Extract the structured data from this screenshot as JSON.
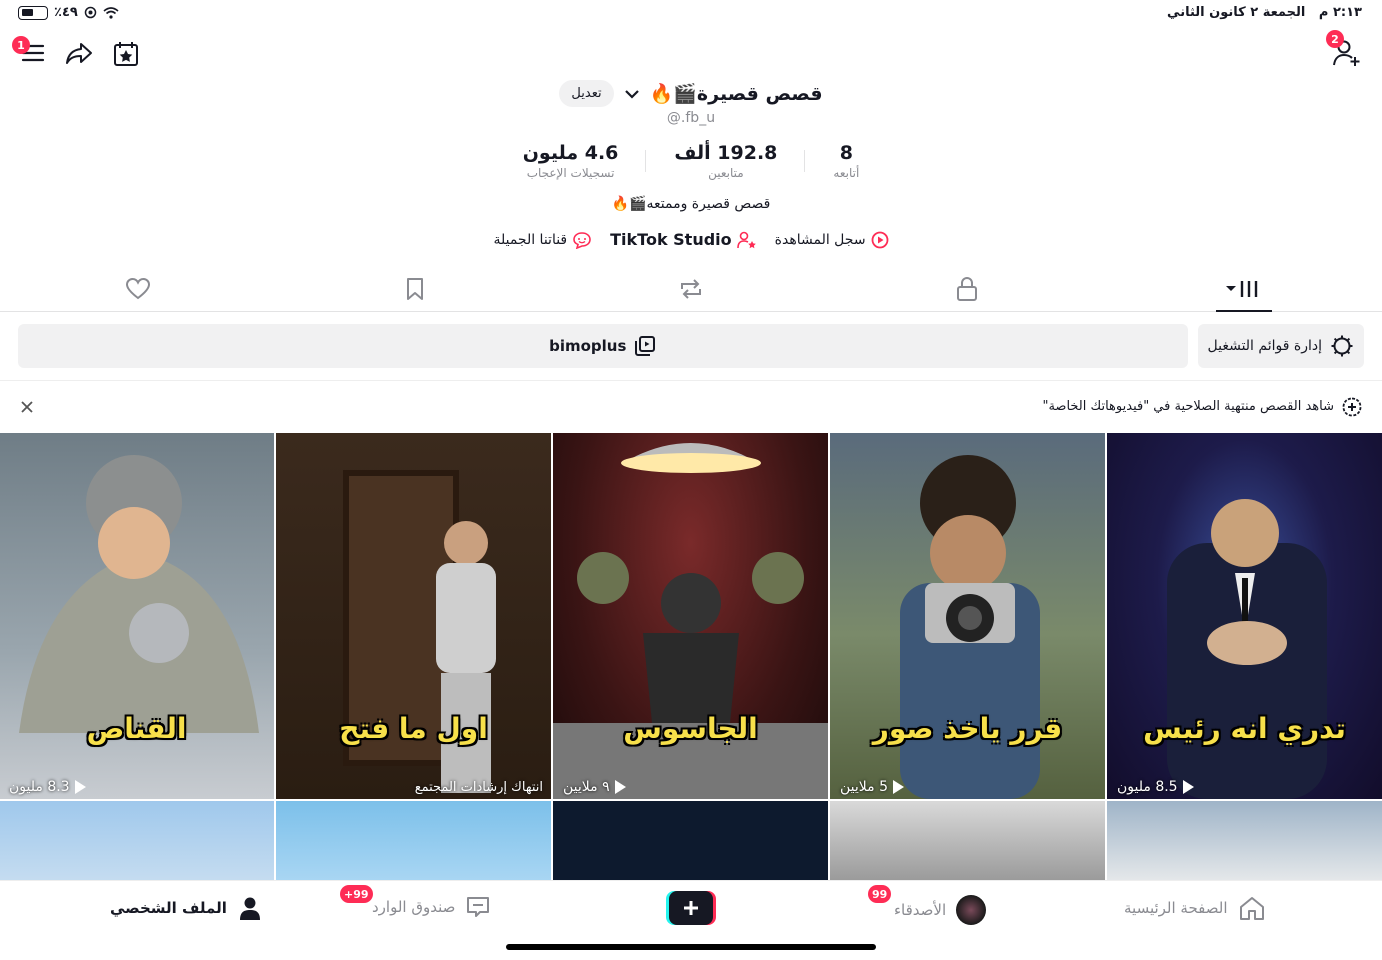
{
  "status": {
    "time": "٢:١٣ م",
    "date": "الجمعة ٢ كانون الثاني",
    "battery": "٪٤٩"
  },
  "header": {
    "menu_badge": "1",
    "follow_badge": "2"
  },
  "profile": {
    "display_name": "قصص قصيرة🎬🔥",
    "edit_label": "تعديل",
    "username": "@.fb_u",
    "stats": [
      {
        "value": "8",
        "label": "أتابعه"
      },
      {
        "value": "192.8 ألف",
        "label": "متابعين"
      },
      {
        "value": "4.6 مليون",
        "label": "تسجيلات الإعجاب"
      }
    ],
    "bio": "قصص قصيرة وممتعه🎬🔥",
    "links": [
      {
        "label": "سجل المشاهدة",
        "icon": "play-circle-icon"
      },
      {
        "label": "TikTok Studio",
        "icon": "creator-icon"
      },
      {
        "label": "قناتنا الجميلة",
        "icon": "chat-bubble-icon"
      }
    ]
  },
  "tabs": [
    "videos-grid-icon",
    "lock-icon",
    "repost-icon",
    "bookmark-icon",
    "heart-icon"
  ],
  "playlists": {
    "manage_label": "إدارة قوائم التشغيل",
    "playlist_name": "bimoplus"
  },
  "notice": {
    "text": "شاهد القصص منتهية الصلاحية في \"فيديوهاتك الخاصة\""
  },
  "videos": [
    {
      "caption": "تدري انه رئيس",
      "views": "8.5 مليون"
    },
    {
      "caption": "قرر ياخذ صور",
      "views": "5 ملايين"
    },
    {
      "caption": "الجاسوس",
      "views": "٩ ملايين"
    },
    {
      "caption": "اول ما فتح",
      "views": "",
      "notice": "انتهاك إرشادات المجتمع"
    },
    {
      "caption": "القناص",
      "views": "8.3 مليون"
    }
  ],
  "colors": {
    "accent": "#fe2c55",
    "caption": "#f7e04a",
    "muted": "#8a8b91"
  },
  "bottom_nav": {
    "home": "الصفحة الرئيسية",
    "friends": "الأصدقاء",
    "friends_badge": "99",
    "inbox": "صندوق الوارد",
    "inbox_badge": "99+",
    "profile": "الملف الشخصي"
  }
}
